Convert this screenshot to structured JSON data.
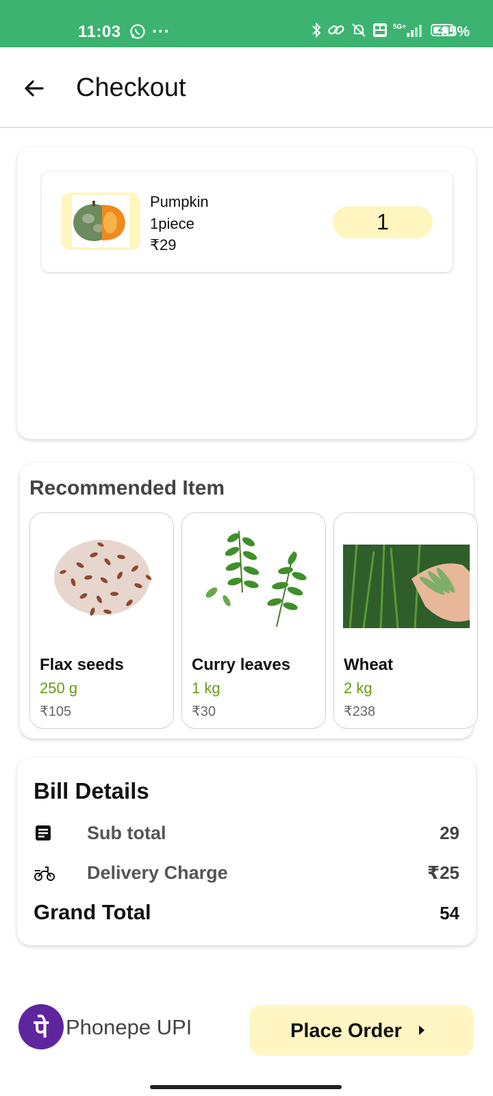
{
  "status_bar": {
    "time": "11:03",
    "dots": "···",
    "battery": "85%",
    "icons": [
      "whatsapp-icon",
      "bluetooth-icon",
      "link-icon",
      "mute-icon",
      "volte-icon",
      "signal-5g-icon",
      "battery-charging-icon"
    ]
  },
  "header": {
    "title": "Checkout"
  },
  "cart": {
    "items": [
      {
        "name": "Pumpkin",
        "unit": "1piece",
        "price": "₹29",
        "quantity": "1"
      }
    ]
  },
  "recommended": {
    "title": "Recommended Item",
    "items": [
      {
        "name": "Flax seeds",
        "quantity": "250 g",
        "price": "₹105"
      },
      {
        "name": "Curry leaves",
        "quantity": "1 kg",
        "price": "₹30"
      },
      {
        "name": "Wheat",
        "quantity": "2 kg",
        "price": "₹238"
      }
    ]
  },
  "bill": {
    "title": "Bill Details",
    "subtotal_label": "Sub total",
    "subtotal_value": "29",
    "delivery_label": "Delivery Charge",
    "delivery_value": "₹25",
    "grand_label": "Grand Total",
    "grand_value": "54"
  },
  "payment": {
    "logo_text": "पे",
    "method": "Phonepe UPI"
  },
  "actions": {
    "place_order": "Place Order"
  },
  "colors": {
    "status_bar": "#3cb371",
    "accent_yellow": "#fff5bf",
    "quantity_green": "#6a9a12",
    "phonepe_purple": "#5f259f"
  }
}
